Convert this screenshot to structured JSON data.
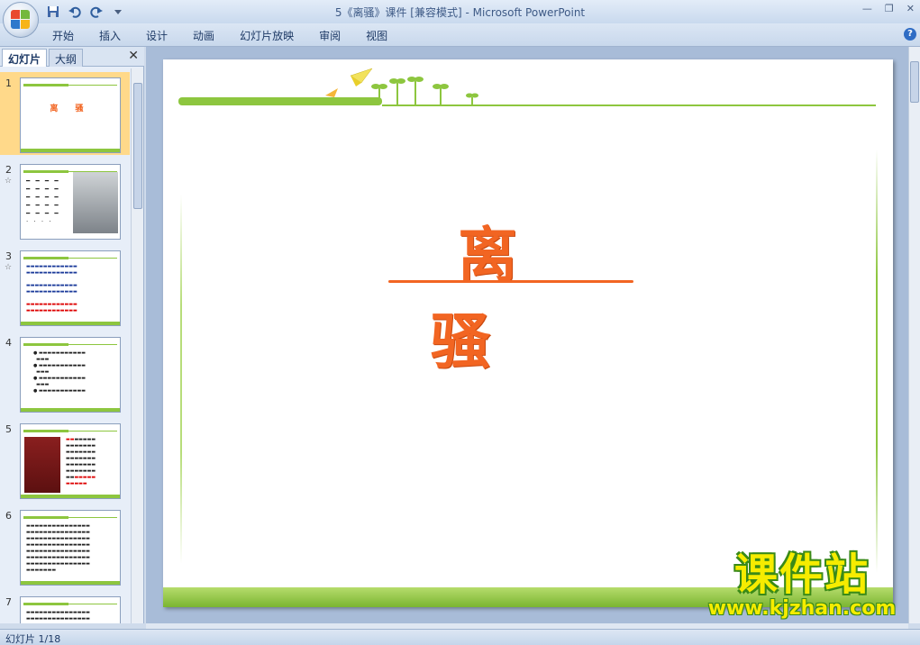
{
  "window": {
    "title": "5《离骚》课件 [兼容模式] - Microsoft PowerPoint"
  },
  "ribbon": {
    "tabs": [
      "开始",
      "插入",
      "设计",
      "动画",
      "幻灯片放映",
      "审阅",
      "视图"
    ]
  },
  "left_pane": {
    "tab_slides": "幻灯片",
    "tab_outline": "大纲",
    "close_glyph": "✕",
    "thumbnails": [
      {
        "number": "1",
        "title": "离 骚",
        "selected": true
      },
      {
        "number": "2",
        "star": "☆"
      },
      {
        "number": "3",
        "star": "☆"
      },
      {
        "number": "4"
      },
      {
        "number": "5"
      },
      {
        "number": "6"
      },
      {
        "number": "7"
      }
    ]
  },
  "slide": {
    "title": "离骚"
  },
  "watermark": {
    "brand": "课件站",
    "url": "www.kjzhan.com"
  },
  "status_bar": {
    "slide_indicator": "幻灯片 1/18"
  },
  "colors": {
    "accent_green": "#8dc63f",
    "title_orange": "#f26522",
    "selection": "#ffd98a"
  }
}
